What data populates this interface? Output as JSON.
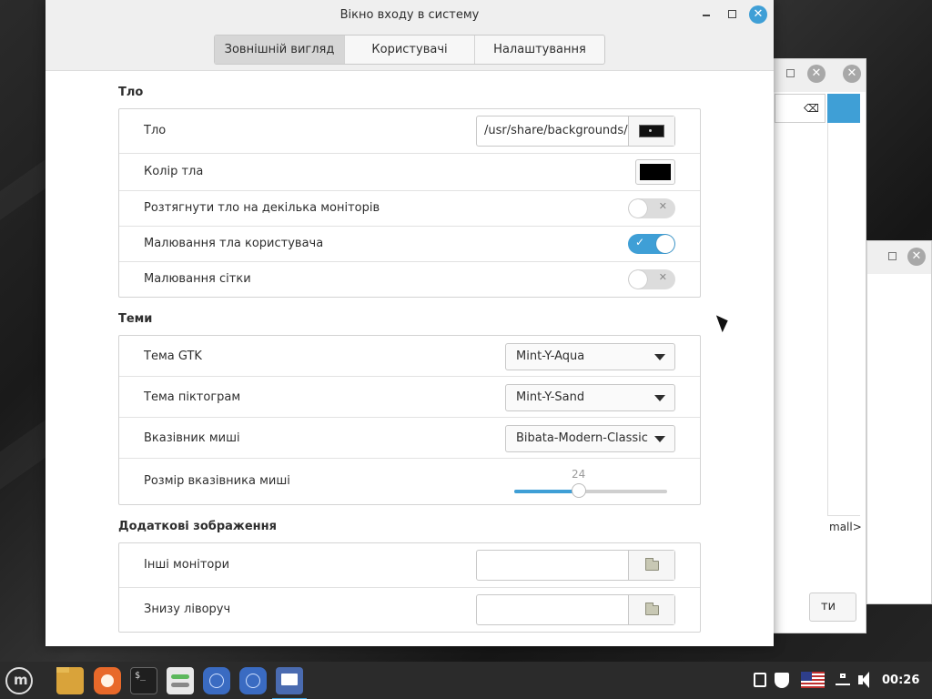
{
  "window": {
    "title": "Вікно входу в систему",
    "tabs": [
      "Зовнішній вигляд",
      "Користувачі",
      "Налаштування"
    ],
    "active_tab": 0
  },
  "background": {
    "section_title": "Тло",
    "rows": {
      "background_label": "Тло",
      "background_path": "/usr/share/backgrounds/",
      "bg_color_label": "Колір тла",
      "bg_color_value": "#000000",
      "stretch_label": "Розтягнути тло на декілька моніторів",
      "stretch_on": false,
      "draw_user_bg_label": "Малювання тла користувача",
      "draw_user_bg_on": true,
      "draw_grid_label": "Малювання сітки",
      "draw_grid_on": false
    }
  },
  "themes": {
    "section_title": "Теми",
    "gtk_label": "Тема GTK",
    "gtk_value": "Mint-Y-Aqua",
    "icon_label": "Тема піктограм",
    "icon_value": "Mint-Y-Sand",
    "cursor_label": "Вказівник миші",
    "cursor_value": "Bibata-Modern-Classic",
    "cursor_size_label": "Розмір вказівника миші",
    "cursor_size_value": "24",
    "cursor_size_fraction": 0.42
  },
  "extra_images": {
    "section_title": "Додаткові зображення",
    "other_monitors_label": "Інші монітори",
    "bottom_left_label": "Знизу ліворуч"
  },
  "background_windows": {
    "text_1": "mall>",
    "text_2": "ти"
  },
  "taskbar": {
    "clock": "00:26",
    "apps": [
      "mint-menu-icon",
      "files-icon",
      "firefox-icon",
      "terminal-icon",
      "settings-icon",
      "window-icon",
      "window-icon",
      "login-window-icon"
    ]
  },
  "colors": {
    "accent": "#3f9fd6",
    "taskbar": "#2b2b2b"
  }
}
